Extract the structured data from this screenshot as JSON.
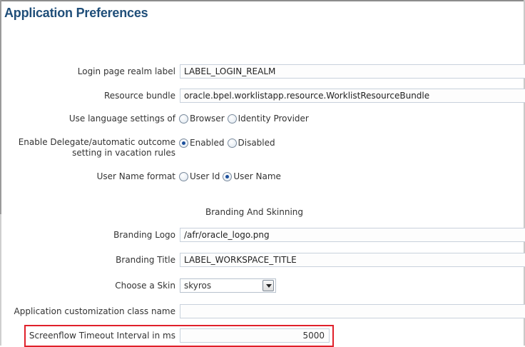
{
  "page": {
    "title": "Application Preferences"
  },
  "login_realm": {
    "label": "Login page realm label",
    "value": "LABEL_LOGIN_REALM"
  },
  "resource_bundle": {
    "label": "Resource bundle",
    "value": "oracle.bpel.worklistapp.resource.WorklistResourceBundle"
  },
  "language": {
    "label": "Use language settings of",
    "options": [
      "Browser",
      "Identity Provider"
    ],
    "selected": "none"
  },
  "delegate": {
    "label": "Enable Delegate/automatic outcome setting in vacation rules",
    "options": [
      "Enabled",
      "Disabled"
    ],
    "selected": "Enabled"
  },
  "username_format": {
    "label": "User Name format",
    "options": [
      "User Id",
      "User Name"
    ],
    "selected": "User Name"
  },
  "branding": {
    "section_heading": "Branding And Skinning",
    "logo_label": "Branding Logo",
    "logo_value": "/afr/oracle_logo.png",
    "title_label": "Branding Title",
    "title_value": "LABEL_WORKSPACE_TITLE",
    "skin_label": "Choose a Skin",
    "skin_value": "skyros",
    "customization_label": "Application customization class name",
    "customization_value": ""
  },
  "screenflow": {
    "label": "Screenflow Timeout Interval in ms",
    "value": "5000"
  },
  "colors": {
    "title": "#1f4e79",
    "highlight_border": "#e0202a",
    "radio_selected": "#1b4f9c"
  }
}
